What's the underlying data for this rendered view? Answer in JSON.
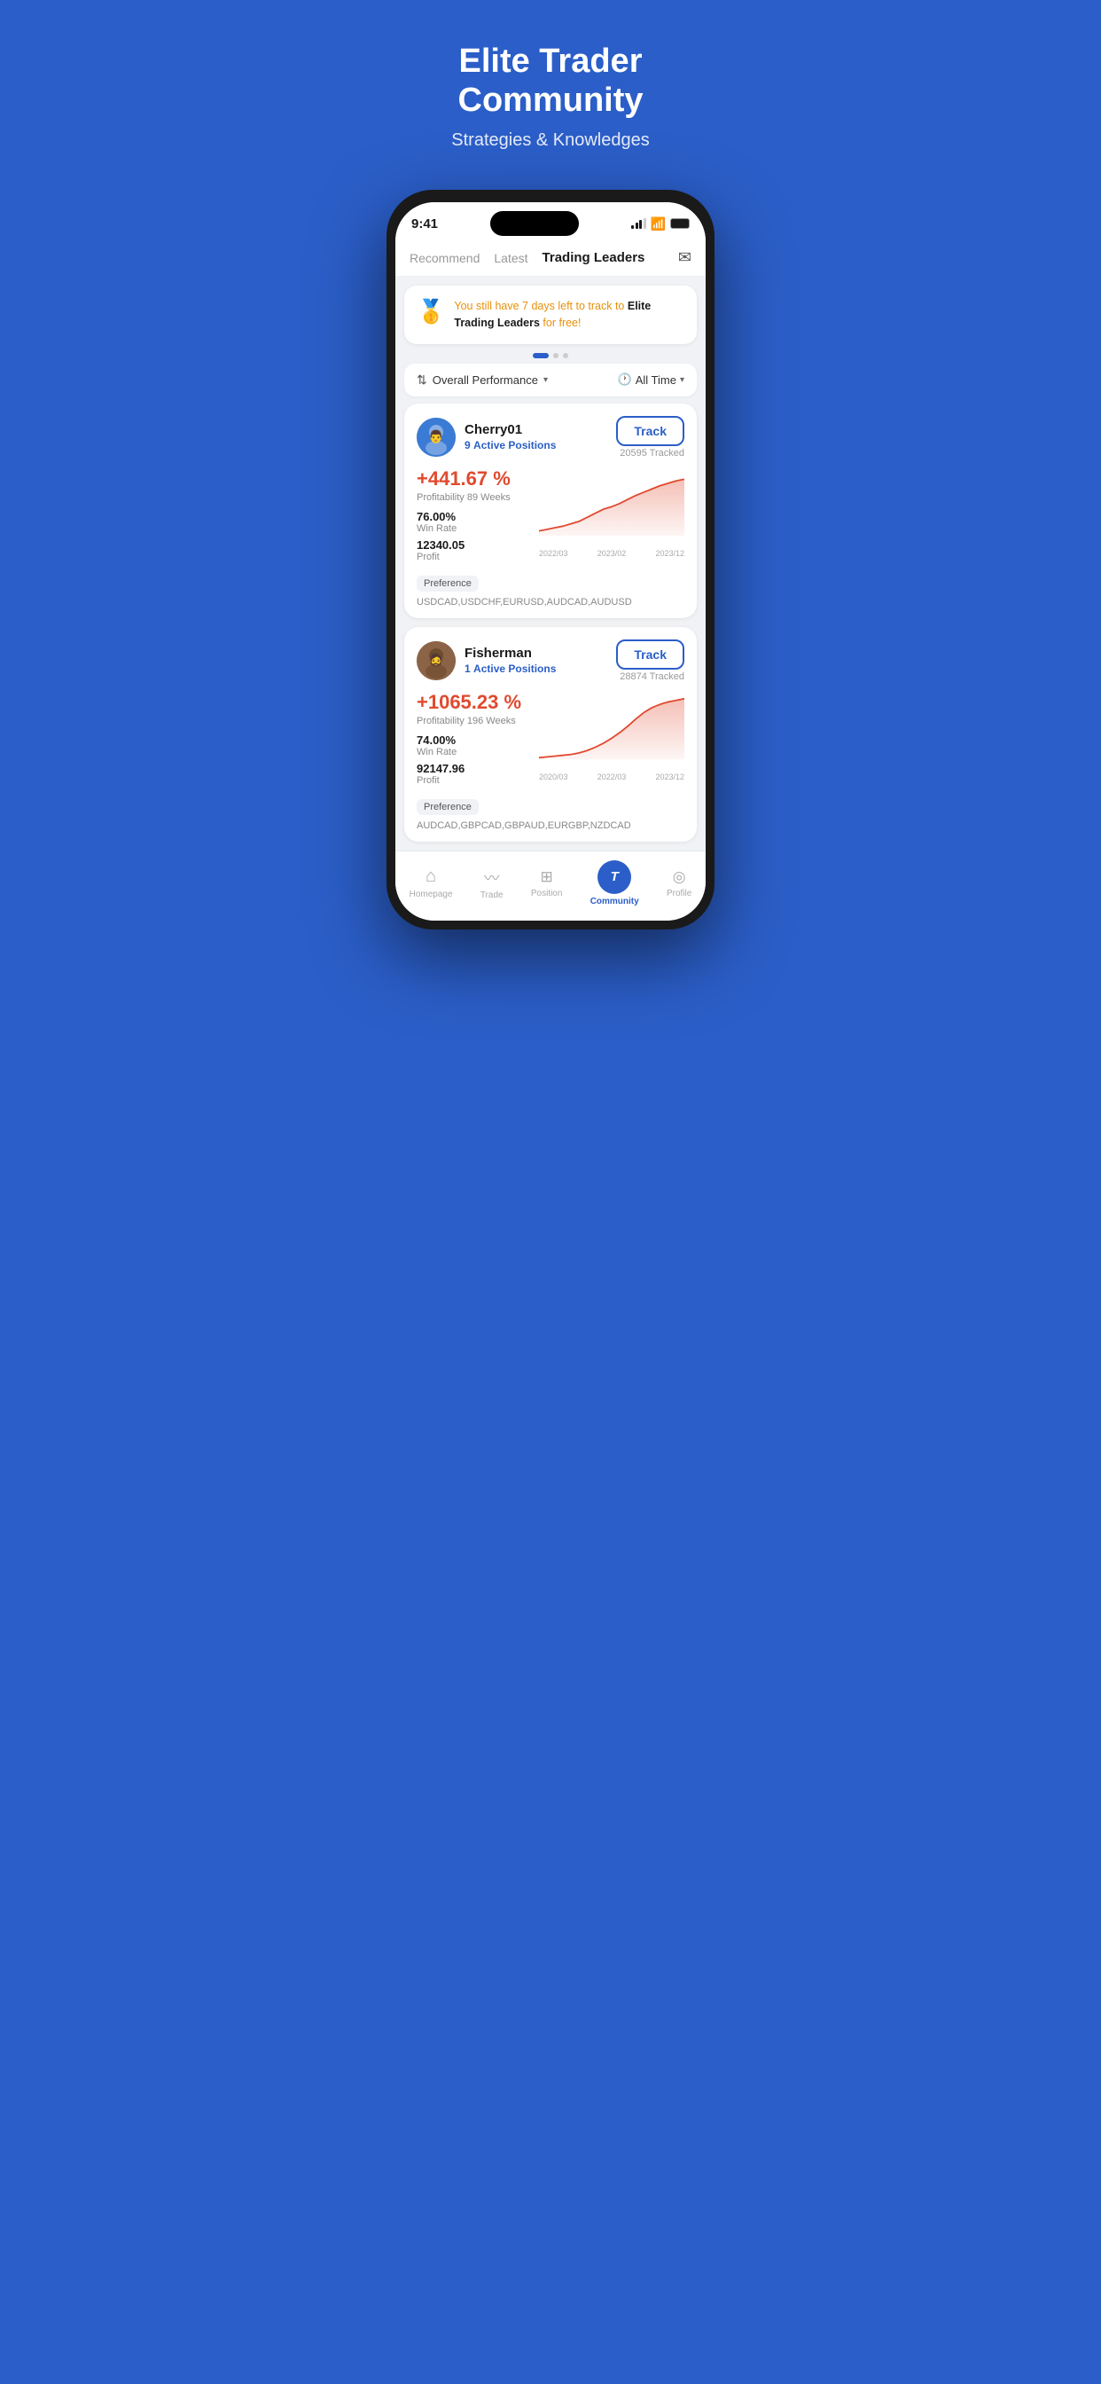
{
  "hero": {
    "title": "Elite Trader\nCommunity",
    "subtitle": "Strategies & Knowledges"
  },
  "status_bar": {
    "time": "9:41"
  },
  "nav_tabs": {
    "items": [
      {
        "label": "Recommend",
        "active": false
      },
      {
        "label": "Latest",
        "active": false
      },
      {
        "label": "Trading Leaders",
        "active": true
      }
    ],
    "mail_icon": "✉"
  },
  "banner": {
    "icon": "🥇",
    "text_highlight": "You still have 7 days left to track to",
    "text_brand": " Elite Trading Leaders",
    "text_end": " for free!"
  },
  "filter": {
    "performance_label": "Overall Performance",
    "time_label": "All Time"
  },
  "traders": [
    {
      "id": "cherry01",
      "name": "Cherry01",
      "active_positions": "9",
      "positions_label": "Active Positions",
      "track_label": "Track",
      "tracked_count": "20595 Tracked",
      "profit_pct": "+441.67 %",
      "profitability_label": "Profitability",
      "profitability_weeks": "89 Weeks",
      "win_rate": "76.00%",
      "win_rate_label": "Win Rate",
      "profit": "12340.05",
      "profit_label": "Profit",
      "preference_label": "Preference",
      "preference_pairs": "USDCAD,USDCHF,EURUSD,AUDCAD,AUDUSD",
      "chart_labels": [
        "2022/03",
        "2023/02",
        "2023/12"
      ],
      "chart_color": "#E04A2F"
    },
    {
      "id": "fisherman",
      "name": "Fisherman",
      "active_positions": "1",
      "positions_label": "Active Positions",
      "track_label": "Track",
      "tracked_count": "28874 Tracked",
      "profit_pct": "+1065.23 %",
      "profitability_label": "Profitability",
      "profitability_weeks": "196 Weeks",
      "win_rate": "74.00%",
      "win_rate_label": "Win Rate",
      "profit": "92147.96",
      "profit_label": "Profit",
      "preference_label": "Preference",
      "preference_pairs": "AUDCAD,GBPCAD,GBPAUD,EURGBP,NZDCAD",
      "chart_labels": [
        "2020/03",
        "2022/03",
        "2023/12"
      ],
      "chart_color": "#E04A2F"
    }
  ],
  "bottom_nav": {
    "items": [
      {
        "icon": "⌂",
        "label": "Homepage",
        "active": false
      },
      {
        "icon": "〜",
        "label": "Trade",
        "active": false
      },
      {
        "icon": "☰",
        "label": "Position",
        "active": false
      },
      {
        "icon": "T",
        "label": "Community",
        "active": true
      },
      {
        "icon": "◉",
        "label": "Profile",
        "active": false
      }
    ]
  }
}
